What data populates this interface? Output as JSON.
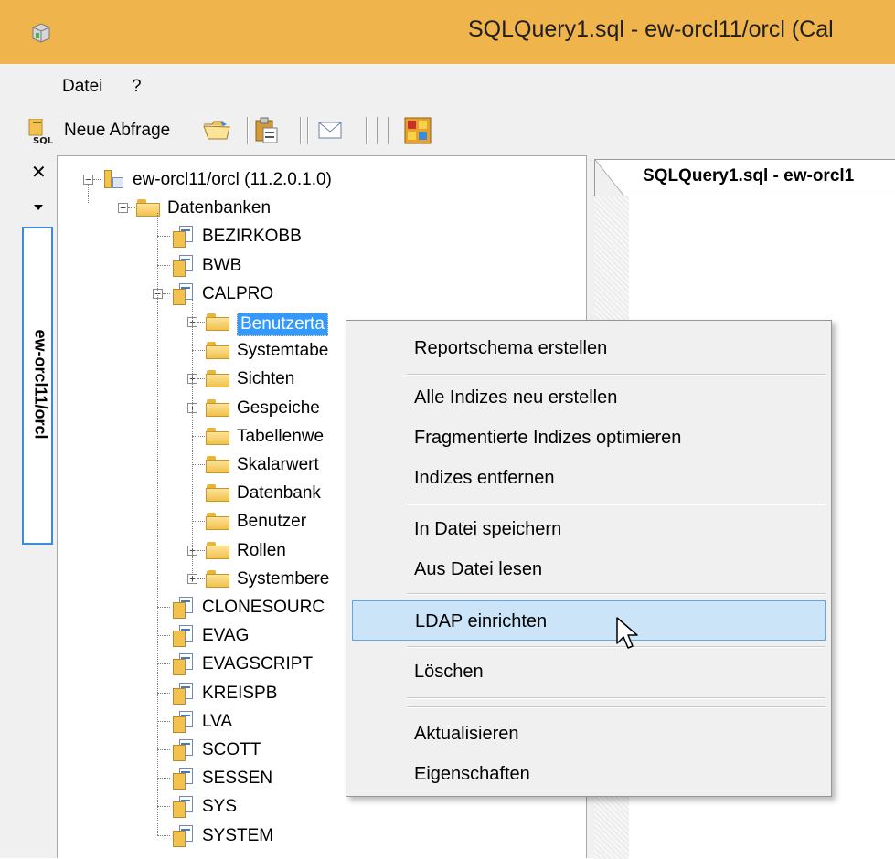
{
  "window": {
    "title": "SQLQuery1.sql - ew-orcl11/orcl (Cal"
  },
  "menubar": {
    "items": [
      {
        "label": "Datei"
      },
      {
        "label": "?"
      }
    ]
  },
  "toolbar": {
    "new_query_label": "Neue Abfrage"
  },
  "left_strip": {
    "connection_tab_label": "ew-orcl11/orcl"
  },
  "tree": {
    "server": "ew-orcl11/orcl (11.2.0.1.0)",
    "databases_folder": "Datenbanken",
    "databases_before": [
      "BEZIRKOBB",
      "BWB",
      "CALPRO"
    ],
    "calpro_children": [
      "Benutzerta",
      "Systemtabe",
      "Sichten",
      "Gespeiche",
      "Tabellenwe",
      "Skalarwert",
      "Datenbank",
      "Benutzer",
      "Rollen",
      "Systembere"
    ],
    "databases_after": [
      "CLONESOURC",
      "EVAG",
      "EVAGSCRIPT",
      "KREISPB",
      "LVA",
      "SCOTT",
      "SESSEN",
      "SYS",
      "SYSTEM"
    ]
  },
  "document": {
    "tab_label": "SQLQuery1.sql - ew-orcl1"
  },
  "context_menu": {
    "items": [
      {
        "label": "Reportschema erstellen"
      },
      {
        "label": "Alle Indizes neu erstellen"
      },
      {
        "label": "Fragmentierte Indizes optimieren"
      },
      {
        "label": "Indizes entfernen"
      },
      {
        "label": "In Datei speichern"
      },
      {
        "label": "Aus Datei lesen"
      },
      {
        "label": "LDAP einrichten",
        "highlighted": true
      },
      {
        "label": "Löschen"
      },
      {
        "label": "Aktualisieren"
      },
      {
        "label": "Eigenschaften"
      }
    ]
  },
  "colors": {
    "title_bar": "#f0b44c",
    "selection": "#3399ff",
    "menu_highlight": "#cce4f7",
    "tab_border": "#3c8ad8"
  }
}
